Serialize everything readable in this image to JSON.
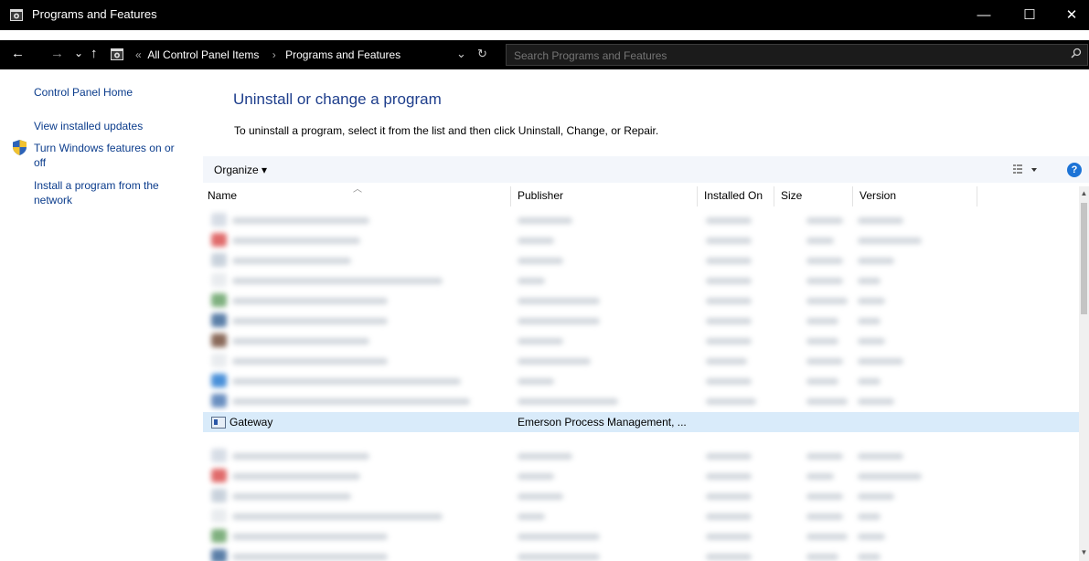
{
  "window": {
    "title": "Programs and Features",
    "controls": {
      "minimize": "—",
      "maximize": "☐",
      "close": "✕"
    }
  },
  "addressbar": {
    "back": "←",
    "forward": "→",
    "recent": "⌄",
    "up": "↑",
    "overflow": "«",
    "breadcrumbs": [
      "All Control Panel Items",
      "Programs and Features"
    ],
    "separator": "›",
    "dropdown": "⌄",
    "refresh": "↻",
    "search_placeholder": "Search Programs and Features"
  },
  "leftpane": {
    "home": "Control Panel Home",
    "view_updates": "View installed updates",
    "windows_features_line1": "Turn Windows features on or",
    "windows_features_line2": "off",
    "install_network_line1": "Install a program from the",
    "install_network_line2": "network"
  },
  "main": {
    "heading": "Uninstall or change a program",
    "instructions": "To uninstall a program, select it from the list and then click Uninstall, Change, or Repair.",
    "organize": "Organize ▾",
    "help": "?"
  },
  "columns": [
    "Name",
    "Publisher",
    "Installed On",
    "Size",
    "Version"
  ],
  "selected_row": {
    "name": "Gateway",
    "publisher": "Emerson Process Management, ..."
  },
  "colors": {
    "titlebar": "#000000",
    "link": "#0b3c8c",
    "heading": "#1e3e8c",
    "selection": "#d9ebfa",
    "help": "#1c73d6"
  }
}
